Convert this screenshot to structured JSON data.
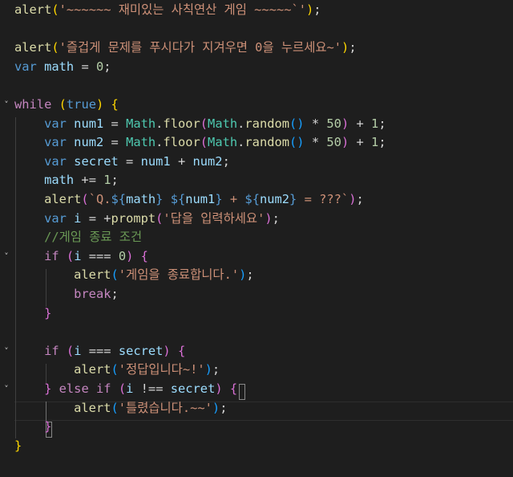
{
  "editor": {
    "lines": [
      [
        {
          "t": "alert",
          "c": "fn"
        },
        {
          "t": "(",
          "c": "b1"
        },
        {
          "t": "'~~~~~~ 재미있는 사칙연산 게임 ~~~~~`'",
          "c": "str"
        },
        {
          "t": ")",
          "c": "b1"
        },
        {
          "t": ";",
          "c": "op"
        }
      ],
      [],
      [
        {
          "t": "alert",
          "c": "fn"
        },
        {
          "t": "(",
          "c": "b1"
        },
        {
          "t": "'즐겁게 문제를 푸시다가 지겨우면 0을 누르세요~'",
          "c": "str"
        },
        {
          "t": ")",
          "c": "b1"
        },
        {
          "t": ";",
          "c": "op"
        }
      ],
      [
        {
          "t": "var",
          "c": "kw"
        },
        {
          "t": " ",
          "c": "op"
        },
        {
          "t": "math",
          "c": "vr"
        },
        {
          "t": " = ",
          "c": "op"
        },
        {
          "t": "0",
          "c": "num"
        },
        {
          "t": ";",
          "c": "op"
        }
      ],
      [],
      [
        {
          "t": "while",
          "c": "ctrl"
        },
        {
          "t": " ",
          "c": "op"
        },
        {
          "t": "(",
          "c": "b1"
        },
        {
          "t": "true",
          "c": "kw"
        },
        {
          "t": ")",
          "c": "b1"
        },
        {
          "t": " ",
          "c": "op"
        },
        {
          "t": "{",
          "c": "b1"
        }
      ],
      [
        {
          "t": "    ",
          "c": "op"
        },
        {
          "t": "var",
          "c": "kw"
        },
        {
          "t": " ",
          "c": "op"
        },
        {
          "t": "num1",
          "c": "vr"
        },
        {
          "t": " = ",
          "c": "op"
        },
        {
          "t": "Math",
          "c": "cls"
        },
        {
          "t": ".",
          "c": "op"
        },
        {
          "t": "floor",
          "c": "fn"
        },
        {
          "t": "(",
          "c": "b2"
        },
        {
          "t": "Math",
          "c": "cls"
        },
        {
          "t": ".",
          "c": "op"
        },
        {
          "t": "random",
          "c": "fn"
        },
        {
          "t": "(",
          "c": "b3"
        },
        {
          "t": ")",
          "c": "b3"
        },
        {
          "t": " * ",
          "c": "op"
        },
        {
          "t": "50",
          "c": "num"
        },
        {
          "t": ")",
          "c": "b2"
        },
        {
          "t": " + ",
          "c": "op"
        },
        {
          "t": "1",
          "c": "num"
        },
        {
          "t": ";",
          "c": "op"
        }
      ],
      [
        {
          "t": "    ",
          "c": "op"
        },
        {
          "t": "var",
          "c": "kw"
        },
        {
          "t": " ",
          "c": "op"
        },
        {
          "t": "num2",
          "c": "vr"
        },
        {
          "t": " = ",
          "c": "op"
        },
        {
          "t": "Math",
          "c": "cls"
        },
        {
          "t": ".",
          "c": "op"
        },
        {
          "t": "floor",
          "c": "fn"
        },
        {
          "t": "(",
          "c": "b2"
        },
        {
          "t": "Math",
          "c": "cls"
        },
        {
          "t": ".",
          "c": "op"
        },
        {
          "t": "random",
          "c": "fn"
        },
        {
          "t": "(",
          "c": "b3"
        },
        {
          "t": ")",
          "c": "b3"
        },
        {
          "t": " * ",
          "c": "op"
        },
        {
          "t": "50",
          "c": "num"
        },
        {
          "t": ")",
          "c": "b2"
        },
        {
          "t": " + ",
          "c": "op"
        },
        {
          "t": "1",
          "c": "num"
        },
        {
          "t": ";",
          "c": "op"
        }
      ],
      [
        {
          "t": "    ",
          "c": "op"
        },
        {
          "t": "var",
          "c": "kw"
        },
        {
          "t": " ",
          "c": "op"
        },
        {
          "t": "secret",
          "c": "vr"
        },
        {
          "t": " = ",
          "c": "op"
        },
        {
          "t": "num1",
          "c": "vr"
        },
        {
          "t": " + ",
          "c": "op"
        },
        {
          "t": "num2",
          "c": "vr"
        },
        {
          "t": ";",
          "c": "op"
        }
      ],
      [
        {
          "t": "    ",
          "c": "op"
        },
        {
          "t": "math",
          "c": "vr"
        },
        {
          "t": " += ",
          "c": "op"
        },
        {
          "t": "1",
          "c": "num"
        },
        {
          "t": ";",
          "c": "op"
        }
      ],
      [
        {
          "t": "    ",
          "c": "op"
        },
        {
          "t": "alert",
          "c": "fn"
        },
        {
          "t": "(",
          "c": "b2"
        },
        {
          "t": "`Q.",
          "c": "str"
        },
        {
          "t": "${",
          "c": "kw"
        },
        {
          "t": "math",
          "c": "vr"
        },
        {
          "t": "}",
          "c": "kw"
        },
        {
          "t": " ",
          "c": "str"
        },
        {
          "t": "${",
          "c": "kw"
        },
        {
          "t": "num1",
          "c": "vr"
        },
        {
          "t": "}",
          "c": "kw"
        },
        {
          "t": " + ",
          "c": "str"
        },
        {
          "t": "${",
          "c": "kw"
        },
        {
          "t": "num2",
          "c": "vr"
        },
        {
          "t": "}",
          "c": "kw"
        },
        {
          "t": " = ???`",
          "c": "str"
        },
        {
          "t": ")",
          "c": "b2"
        },
        {
          "t": ";",
          "c": "op"
        }
      ],
      [
        {
          "t": "    ",
          "c": "op"
        },
        {
          "t": "var",
          "c": "kw"
        },
        {
          "t": " ",
          "c": "op"
        },
        {
          "t": "i",
          "c": "vr"
        },
        {
          "t": " = +",
          "c": "op"
        },
        {
          "t": "prompt",
          "c": "fn"
        },
        {
          "t": "(",
          "c": "b2"
        },
        {
          "t": "'답을 입력하세요'",
          "c": "str"
        },
        {
          "t": ")",
          "c": "b2"
        },
        {
          "t": ";",
          "c": "op"
        }
      ],
      [
        {
          "t": "    ",
          "c": "op"
        },
        {
          "t": "//게임 종료 조건",
          "c": "cmt"
        }
      ],
      [
        {
          "t": "    ",
          "c": "op"
        },
        {
          "t": "if",
          "c": "ctrl"
        },
        {
          "t": " ",
          "c": "op"
        },
        {
          "t": "(",
          "c": "b2"
        },
        {
          "t": "i",
          "c": "vr"
        },
        {
          "t": " === ",
          "c": "op"
        },
        {
          "t": "0",
          "c": "num"
        },
        {
          "t": ")",
          "c": "b2"
        },
        {
          "t": " ",
          "c": "op"
        },
        {
          "t": "{",
          "c": "b2"
        }
      ],
      [
        {
          "t": "        ",
          "c": "op"
        },
        {
          "t": "alert",
          "c": "fn"
        },
        {
          "t": "(",
          "c": "b3"
        },
        {
          "t": "'게임을 종료합니다.'",
          "c": "str"
        },
        {
          "t": ")",
          "c": "b3"
        },
        {
          "t": ";",
          "c": "op"
        }
      ],
      [
        {
          "t": "        ",
          "c": "op"
        },
        {
          "t": "break",
          "c": "ctrl"
        },
        {
          "t": ";",
          "c": "op"
        }
      ],
      [
        {
          "t": "    ",
          "c": "op"
        },
        {
          "t": "}",
          "c": "b2"
        }
      ],
      [],
      [
        {
          "t": "    ",
          "c": "op"
        },
        {
          "t": "if",
          "c": "ctrl"
        },
        {
          "t": " ",
          "c": "op"
        },
        {
          "t": "(",
          "c": "b2"
        },
        {
          "t": "i",
          "c": "vr"
        },
        {
          "t": " === ",
          "c": "op"
        },
        {
          "t": "secret",
          "c": "vr"
        },
        {
          "t": ")",
          "c": "b2"
        },
        {
          "t": " ",
          "c": "op"
        },
        {
          "t": "{",
          "c": "b2"
        }
      ],
      [
        {
          "t": "        ",
          "c": "op"
        },
        {
          "t": "alert",
          "c": "fn"
        },
        {
          "t": "(",
          "c": "b3"
        },
        {
          "t": "'정답입니다~!'",
          "c": "str"
        },
        {
          "t": ")",
          "c": "b3"
        },
        {
          "t": ";",
          "c": "op"
        }
      ],
      [
        {
          "t": "    ",
          "c": "op"
        },
        {
          "t": "}",
          "c": "b2"
        },
        {
          "t": " ",
          "c": "op"
        },
        {
          "t": "else",
          "c": "ctrl"
        },
        {
          "t": " ",
          "c": "op"
        },
        {
          "t": "if",
          "c": "ctrl"
        },
        {
          "t": " ",
          "c": "op"
        },
        {
          "t": "(",
          "c": "b2"
        },
        {
          "t": "i",
          "c": "vr"
        },
        {
          "t": " !== ",
          "c": "op"
        },
        {
          "t": "secret",
          "c": "vr"
        },
        {
          "t": ")",
          "c": "b2"
        },
        {
          "t": " ",
          "c": "op"
        },
        {
          "t": "{",
          "c": "b2"
        }
      ],
      [
        {
          "t": "        ",
          "c": "op"
        },
        {
          "t": "alert",
          "c": "fn"
        },
        {
          "t": "(",
          "c": "b3"
        },
        {
          "t": "'틀렸습니다.~~'",
          "c": "str"
        },
        {
          "t": ")",
          "c": "b3"
        },
        {
          "t": ";",
          "c": "op"
        }
      ],
      [
        {
          "t": "    ",
          "c": "op"
        },
        {
          "t": "}",
          "c": "b2"
        }
      ],
      [
        {
          "t": "}",
          "c": "b1"
        }
      ]
    ],
    "fold_lines": [
      5,
      13,
      18,
      20
    ],
    "colors": {
      "background": "#1e1e1e",
      "function": "#dcdcaa",
      "string": "#ce9178",
      "keyword": "#569cd6",
      "control": "#c586c0",
      "variable": "#9cdcfe",
      "class": "#4ec9b0",
      "number": "#b5cea8",
      "comment": "#6a9955",
      "bracket_level_1": "#ffd700",
      "bracket_level_2": "#da70d6",
      "bracket_level_3": "#179fff"
    }
  }
}
